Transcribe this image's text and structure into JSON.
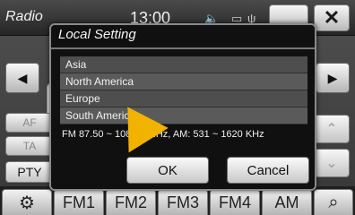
{
  "header": {
    "title": "Radio",
    "clock": "13:00",
    "icons": [
      "mute-icon",
      "battery-icon",
      "usb-icon"
    ],
    "close_glyph": "✕"
  },
  "side": {
    "prev_glyph": "◀",
    "next_glyph": "▶",
    "af": "AF",
    "ta": "TA",
    "pty": "PTY",
    "up_glyph": "⌃",
    "down_glyph": "⌄"
  },
  "tabs": [
    "FM1",
    "FM2",
    "FM3",
    "FM4",
    "AM"
  ],
  "dialog": {
    "title": "Local Setting",
    "regions": [
      "Asia",
      "North America",
      "Europe",
      "South America"
    ],
    "range_text": "FM 87.50 ~ 108.00 MHz, AM: 531 ~ 1620 KHz",
    "ok_label": "OK",
    "cancel_label": "Cancel"
  },
  "colors": {
    "pointer": "#f2b300",
    "dialog_bg": "#101010",
    "list_bg": "#4e4e4e"
  }
}
